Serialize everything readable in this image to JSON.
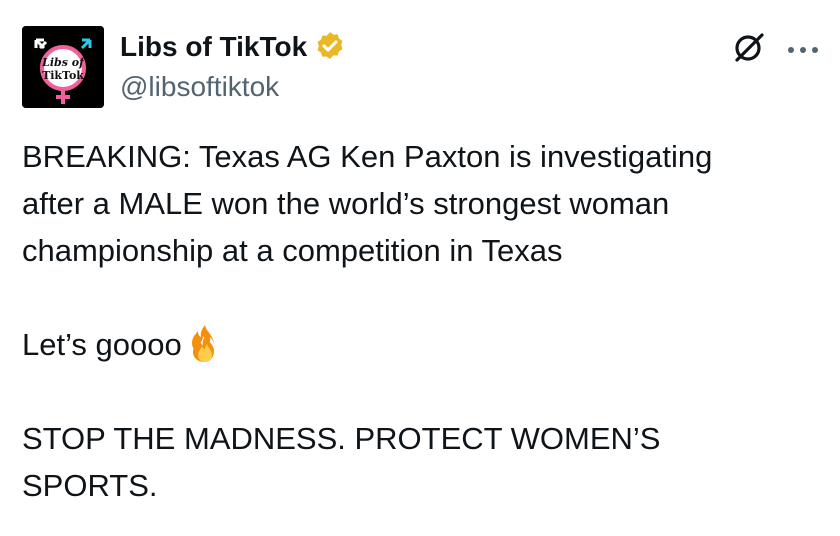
{
  "author": {
    "display_name": "Libs of TikTok",
    "handle": "@libsoftiktok",
    "avatar_text_line1": "Libs of",
    "avatar_text_line2": "TikTok",
    "verified_color": "#E8B829"
  },
  "actions": {
    "grok_icon": "grok-icon",
    "more_icon": "more-icon"
  },
  "tweet": {
    "line1": "BREAKING: Texas AG Ken Paxton is investigating",
    "line2": "after a MALE won the world’s strongest woman",
    "line3": "championship at a competition in Texas",
    "line4": "Let’s goooo",
    "line5": "STOP THE MADNESS. PROTECT WOMEN’S",
    "line6": "SPORTS."
  },
  "icons": {
    "emoji": "fire-icon"
  },
  "colors": {
    "text": "#0f1419",
    "secondary": "#536471",
    "gold": "#E8B829"
  }
}
